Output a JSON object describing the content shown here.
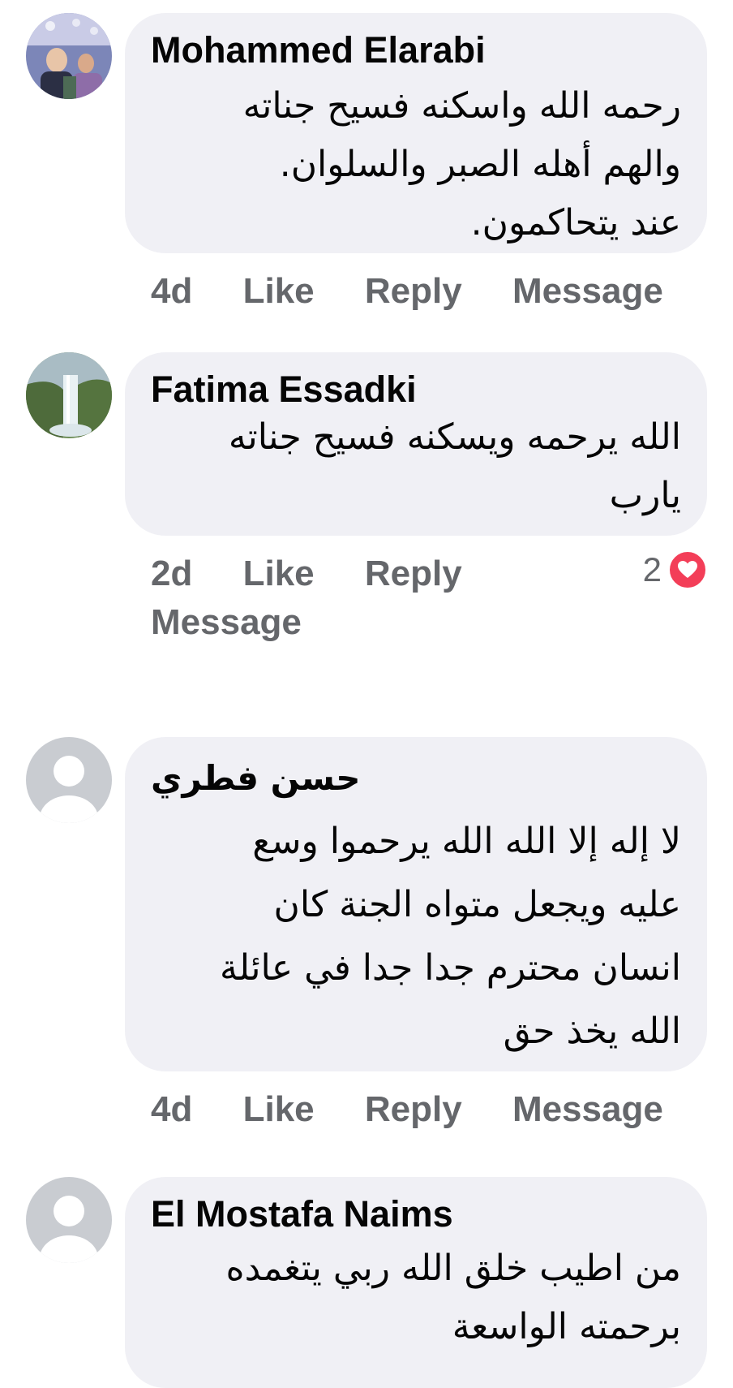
{
  "comments": [
    {
      "author": "Mohammed Elarabi",
      "lines": [
        "رحمه الله واسكنه فسيح جناته",
        "والهم أهله الصبر والسلوان.",
        "عند يتحاكمون."
      ],
      "time": "4d",
      "like": "Like",
      "reply": "Reply",
      "message": "Message"
    },
    {
      "author": "Fatima Essadki",
      "lines": [
        "الله يرحمه ويسكنه فسيح جناته",
        "يارب"
      ],
      "time": "2d",
      "like": "Like",
      "reply": "Reply",
      "message": "Message",
      "reaction_count": "2",
      "reaction_icon": "heart-icon"
    },
    {
      "author": "حسن فطري",
      "lines": [
        "لا إله إلا الله الله يرحموا وسع",
        "عليه ويجعل متواه الجنة كان",
        "انسان محترم جدا جدا في عائلة",
        "الله يخذ حق"
      ],
      "time": "4d",
      "like": "Like",
      "reply": "Reply",
      "message": "Message"
    },
    {
      "author": "El Mostafa Naims",
      "lines": [
        "من اطيب خلق الله ربي يتغمده",
        "برحمته الواسعة"
      ]
    }
  ],
  "colors": {
    "bubble": "#f0f0f5",
    "action_text": "#65676b",
    "heart": "#f33e58",
    "placeholder_avatar": "#c9ccd1"
  }
}
